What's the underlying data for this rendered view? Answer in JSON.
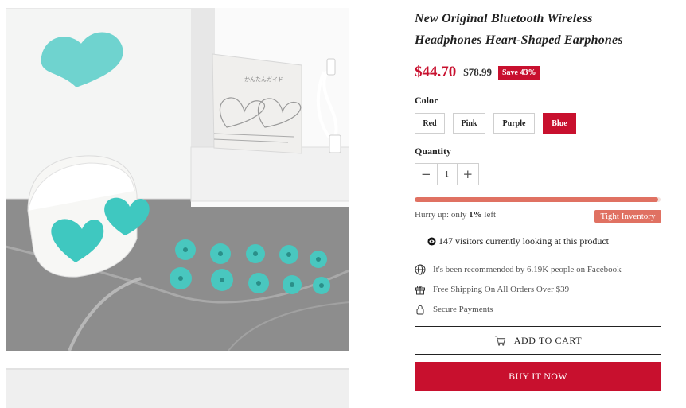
{
  "product": {
    "title": "New Original Bluetooth Wireless Headphones Heart-Shaped Earphones",
    "price": "$44.70",
    "compare_price": "$78.99",
    "save_badge": "Save 43%"
  },
  "options": {
    "color_label": "Color",
    "colors": [
      {
        "label": "Red",
        "selected": false
      },
      {
        "label": "Pink",
        "selected": false
      },
      {
        "label": "Purple",
        "selected": false
      },
      {
        "label": "Blue",
        "selected": true
      }
    ],
    "quantity_label": "Quantity",
    "quantity_value": "1",
    "minus_label": "−",
    "plus_label": "+"
  },
  "inventory": {
    "hurry_prefix": "Hurry up: only ",
    "hurry_count": "1%",
    "hurry_suffix": " left",
    "badge": "Tight Inventory",
    "bar_fraction": 0.99
  },
  "visitors": {
    "text": "147 visitors currently looking at this product"
  },
  "features": [
    {
      "icon": "globe-icon",
      "text": "It's been recommended by 6.19K people on Facebook"
    },
    {
      "icon": "gift-icon",
      "text": "Free Shipping On All Orders Over $39"
    },
    {
      "icon": "lock-icon",
      "text": "Secure Payments"
    }
  ],
  "buttons": {
    "add_to_cart": "ADD TO CART",
    "buy_now": "BUY IT NOW"
  },
  "gallery": {
    "box_caption": "かんたんガイド"
  },
  "colors": {
    "accent": "#c8102e",
    "inventory": "#e07162",
    "earbud": "#3fc8c0"
  }
}
